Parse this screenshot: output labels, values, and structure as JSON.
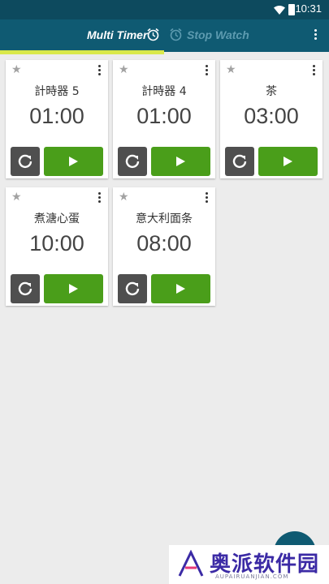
{
  "status_bar": {
    "time": "10:31"
  },
  "app_bar": {
    "tabs": [
      {
        "label": "Multi Timer",
        "active": true
      },
      {
        "label": "Stop Watch",
        "active": false
      }
    ]
  },
  "timers": [
    {
      "name": "計時器 5",
      "time": "01:00"
    },
    {
      "name": "計時器 4",
      "time": "01:00"
    },
    {
      "name": "茶",
      "time": "03:00"
    },
    {
      "name": "煮溏心蛋",
      "time": "10:00"
    },
    {
      "name": "意大利面条",
      "time": "08:00"
    }
  ],
  "watermark": {
    "text": "奥派软件园",
    "subtext": "AUPAIRUANJIAN.COM"
  },
  "colors": {
    "app_bar": "#0f5a72",
    "status_bar": "#0d4a5e",
    "tab_indicator": "#d9e84a",
    "play_button": "#4a9e1a",
    "reset_button": "#4f4f4f",
    "background": "#ececec"
  }
}
